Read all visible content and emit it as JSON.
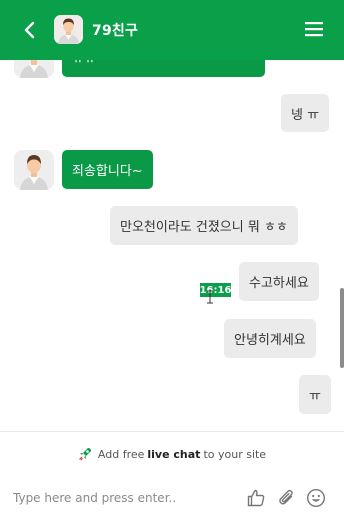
{
  "header": {
    "title": "79친구",
    "back_icon": "chevron-left-icon",
    "menu_icon": "hamburger-menu-icon",
    "bg_color": "#0aa04a"
  },
  "messages": [
    {
      "direction": "in",
      "text": "ㅠㅠ"
    },
    {
      "direction": "out",
      "text": "넹 ㅠ"
    },
    {
      "direction": "in",
      "text": "죄송합니다~"
    },
    {
      "direction": "out",
      "text": "만오천이라도 건졌으니 뭐 ㅎㅎ"
    },
    {
      "direction": "out",
      "text": "수고하세요"
    },
    {
      "direction": "out",
      "text": "안녕히계세요"
    },
    {
      "direction": "out",
      "text": "ㅠ"
    }
  ],
  "tooltip": {
    "time": "16:16"
  },
  "promo": {
    "prefix": "Add free",
    "highlight": "live chat",
    "suffix": "to your site"
  },
  "composer": {
    "placeholder": "Type here and press enter..",
    "icons": [
      "thumbs-up-icon",
      "paperclip-icon",
      "smiley-icon"
    ]
  }
}
